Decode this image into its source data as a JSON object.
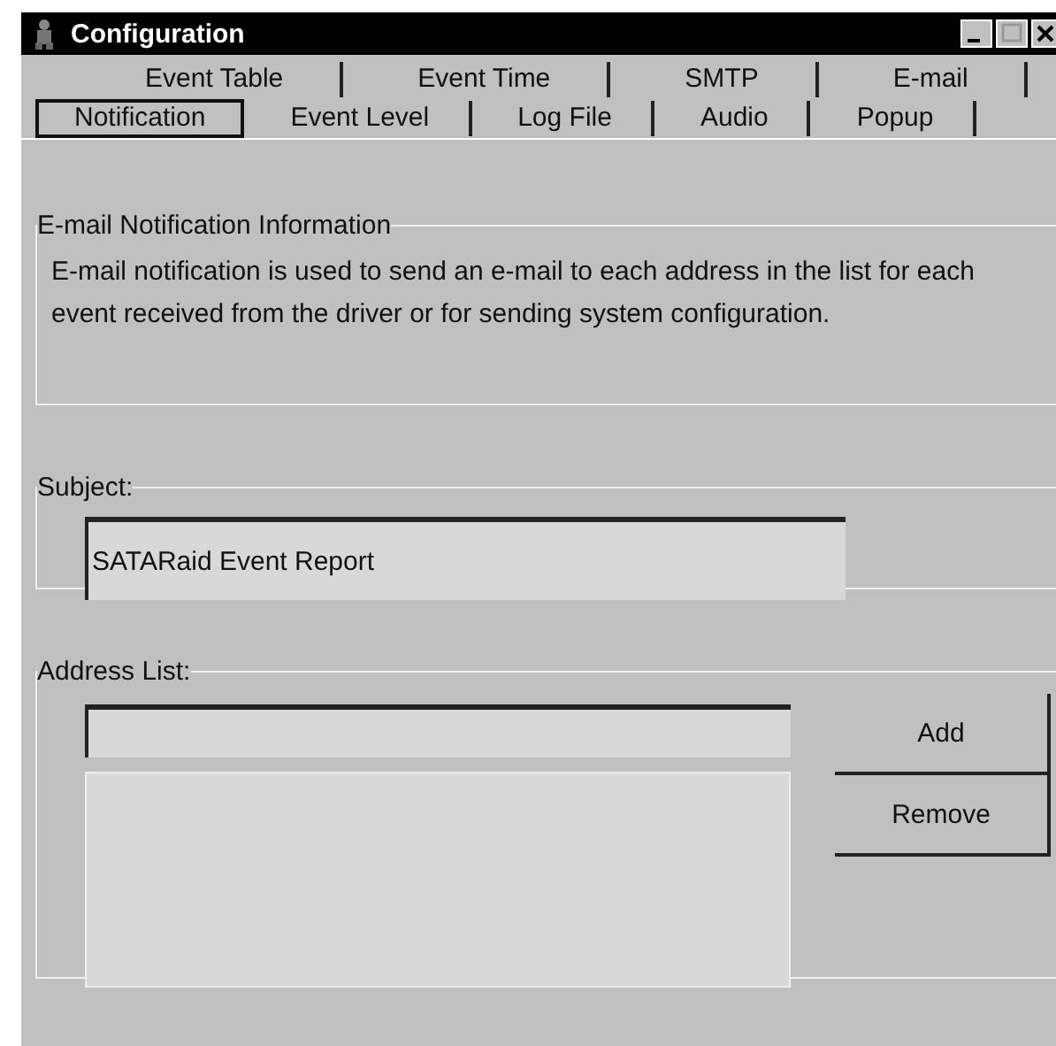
{
  "window": {
    "title": "Configuration"
  },
  "tab_rows": [
    {
      "tabs": [
        {
          "label": "Event Table",
          "selected": false
        },
        {
          "label": "Event Time",
          "selected": false
        },
        {
          "label": "SMTP",
          "selected": false
        },
        {
          "label": "E-mail",
          "selected": false
        }
      ]
    },
    {
      "tabs": [
        {
          "label": "Notification",
          "selected": true
        },
        {
          "label": "Event Level",
          "selected": false
        },
        {
          "label": "Log File",
          "selected": false
        },
        {
          "label": "Audio",
          "selected": false
        },
        {
          "label": "Popup",
          "selected": false
        }
      ]
    }
  ],
  "info_group": {
    "title": "E-mail Notification Information",
    "text": "E-mail notification is used to send an e-mail to each address in the list for each event received from the driver or for sending system configuration."
  },
  "subject_group": {
    "title": "Subject:",
    "value": "SATARaid Event Report"
  },
  "address_group": {
    "title": "Address List:",
    "buttons": [
      "Add",
      "Remove"
    ]
  }
}
